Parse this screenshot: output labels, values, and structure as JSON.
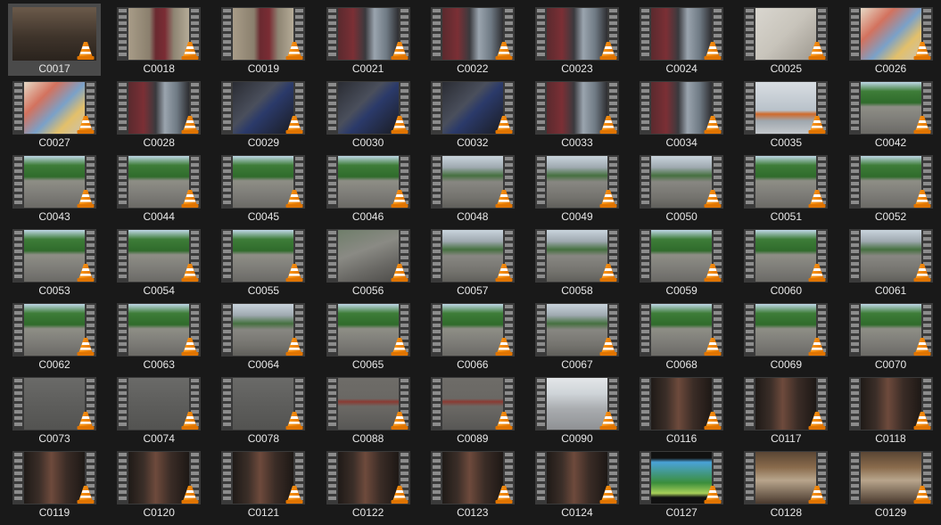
{
  "icons": {
    "thumbnail_badge": "vlc-cone-icon",
    "filmstrip": "filmstrip-frame"
  },
  "colors": {
    "background": "#191919",
    "selected_tile": "#4a4a4a",
    "label_text": "#e8e8e8",
    "cone_orange": "#f08a00"
  },
  "files": [
    {
      "name": "C0017",
      "scene": "indoor-table",
      "selected": true,
      "filmstrip": false
    },
    {
      "name": "C0018",
      "scene": "indoor-person"
    },
    {
      "name": "C0019",
      "scene": "indoor-person"
    },
    {
      "name": "C0021",
      "scene": "desk-monitor"
    },
    {
      "name": "C0022",
      "scene": "desk-monitor"
    },
    {
      "name": "C0023",
      "scene": "desk-monitor"
    },
    {
      "name": "C0024",
      "scene": "desk-monitor"
    },
    {
      "name": "C0025",
      "scene": "paper"
    },
    {
      "name": "C0026",
      "scene": "paper-color"
    },
    {
      "name": "C0027",
      "scene": "paper-color"
    },
    {
      "name": "C0028",
      "scene": "desk-monitor"
    },
    {
      "name": "C0029",
      "scene": "controller"
    },
    {
      "name": "C0030",
      "scene": "controller"
    },
    {
      "name": "C0032",
      "scene": "controller"
    },
    {
      "name": "C0033",
      "scene": "desk-monitor"
    },
    {
      "name": "C0034",
      "scene": "desk-monitor"
    },
    {
      "name": "C0035",
      "scene": "ball"
    },
    {
      "name": "C0042",
      "scene": "court-trees"
    },
    {
      "name": "C0043",
      "scene": "court-trees"
    },
    {
      "name": "C0044",
      "scene": "court-trees"
    },
    {
      "name": "C0045",
      "scene": "court-trees"
    },
    {
      "name": "C0046",
      "scene": "court-trees"
    },
    {
      "name": "C0048",
      "scene": "court-buildings"
    },
    {
      "name": "C0049",
      "scene": "court-buildings"
    },
    {
      "name": "C0050",
      "scene": "court-buildings"
    },
    {
      "name": "C0051",
      "scene": "court-trees"
    },
    {
      "name": "C0052",
      "scene": "court-trees"
    },
    {
      "name": "C0053",
      "scene": "court-trees"
    },
    {
      "name": "C0054",
      "scene": "court-trees"
    },
    {
      "name": "C0055",
      "scene": "court-trees"
    },
    {
      "name": "C0056",
      "scene": "court-blur"
    },
    {
      "name": "C0057",
      "scene": "court-buildings"
    },
    {
      "name": "C0058",
      "scene": "court-buildings"
    },
    {
      "name": "C0059",
      "scene": "court-trees"
    },
    {
      "name": "C0060",
      "scene": "court-trees"
    },
    {
      "name": "C0061",
      "scene": "court-buildings"
    },
    {
      "name": "C0062",
      "scene": "court-trees"
    },
    {
      "name": "C0063",
      "scene": "court-trees"
    },
    {
      "name": "C0064",
      "scene": "court-buildings"
    },
    {
      "name": "C0065",
      "scene": "court-trees"
    },
    {
      "name": "C0066",
      "scene": "court-trees"
    },
    {
      "name": "C0067",
      "scene": "court-buildings"
    },
    {
      "name": "C0068",
      "scene": "court-trees"
    },
    {
      "name": "C0069",
      "scene": "court-trees"
    },
    {
      "name": "C0070",
      "scene": "court-trees"
    },
    {
      "name": "C0073",
      "scene": "asphalt"
    },
    {
      "name": "C0074",
      "scene": "asphalt"
    },
    {
      "name": "C0078",
      "scene": "asphalt"
    },
    {
      "name": "C0088",
      "scene": "asphalt-red"
    },
    {
      "name": "C0089",
      "scene": "asphalt-red"
    },
    {
      "name": "C0090",
      "scene": "court-bright"
    },
    {
      "name": "C0116",
      "scene": "room-dark"
    },
    {
      "name": "C0117",
      "scene": "room-dark"
    },
    {
      "name": "C0118",
      "scene": "room-dark"
    },
    {
      "name": "C0119",
      "scene": "room-dark"
    },
    {
      "name": "C0120",
      "scene": "room-dark"
    },
    {
      "name": "C0121",
      "scene": "room-dark"
    },
    {
      "name": "C0122",
      "scene": "room-dark"
    },
    {
      "name": "C0123",
      "scene": "room-dark"
    },
    {
      "name": "C0124",
      "scene": "room-dark"
    },
    {
      "name": "C0127",
      "scene": "tv-game"
    },
    {
      "name": "C0128",
      "scene": "room-warm"
    },
    {
      "name": "C0129",
      "scene": "room-warm"
    }
  ]
}
